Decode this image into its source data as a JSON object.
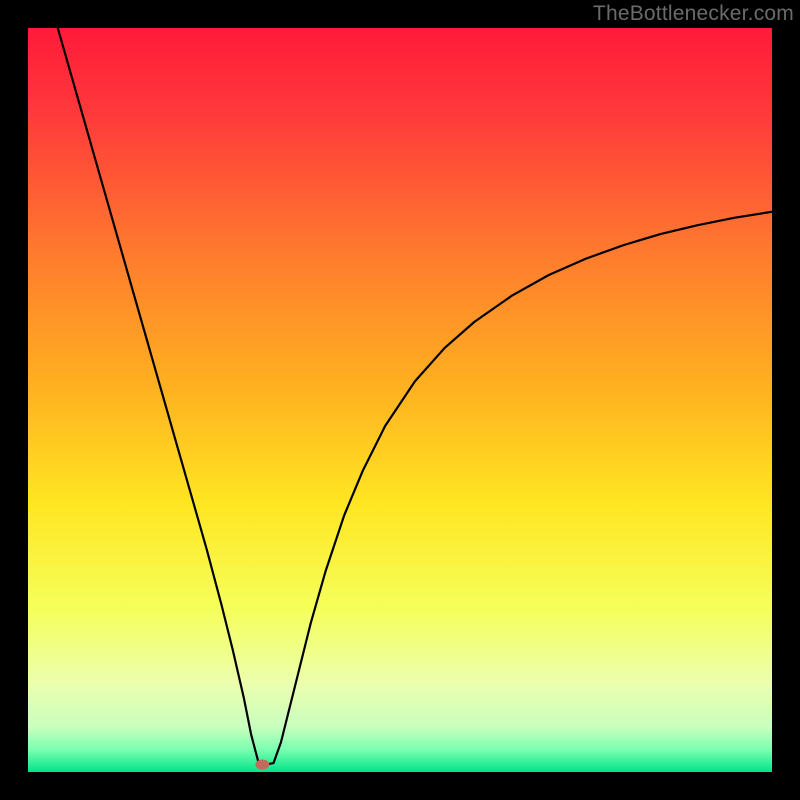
{
  "watermark": "TheBottlenecker.com",
  "chart_data": {
    "type": "line",
    "title": "",
    "xlabel": "",
    "ylabel": "",
    "xlim": [
      0,
      100
    ],
    "ylim": [
      0,
      100
    ],
    "grid": false,
    "background_gradient_stops": [
      {
        "pos": 0.0,
        "color": "#ff1a3a"
      },
      {
        "pos": 0.12,
        "color": "#ff3b3b"
      },
      {
        "pos": 0.3,
        "color": "#ff7a2e"
      },
      {
        "pos": 0.48,
        "color": "#ffb020"
      },
      {
        "pos": 0.64,
        "color": "#ffe622"
      },
      {
        "pos": 0.78,
        "color": "#f5ff5a"
      },
      {
        "pos": 0.88,
        "color": "#ecffad"
      },
      {
        "pos": 0.94,
        "color": "#c8ffbf"
      },
      {
        "pos": 0.97,
        "color": "#7affb0"
      },
      {
        "pos": 1.0,
        "color": "#00e48a"
      }
    ],
    "marker": {
      "x": 31.5,
      "y": 1.0,
      "color": "#c46a5c"
    },
    "series": [
      {
        "name": "bottleneck-curve",
        "color": "#000000",
        "x": [
          4.0,
          6.0,
          8.0,
          10.0,
          12.0,
          14.0,
          16.0,
          18.0,
          20.0,
          22.0,
          24.0,
          26.0,
          27.5,
          29.0,
          30.0,
          31.0,
          32.0,
          33.0,
          34.0,
          36.0,
          38.0,
          40.0,
          42.5,
          45.0,
          48.0,
          52.0,
          56.0,
          60.0,
          65.0,
          70.0,
          75.0,
          80.0,
          85.0,
          90.0,
          95.0,
          100.0
        ],
        "y": [
          100.0,
          93.0,
          86.0,
          79.0,
          72.0,
          65.0,
          58.0,
          51.0,
          44.0,
          37.0,
          30.0,
          22.5,
          16.5,
          10.0,
          5.0,
          1.2,
          1.0,
          1.2,
          4.0,
          12.0,
          20.0,
          27.0,
          34.5,
          40.5,
          46.5,
          52.5,
          57.0,
          60.5,
          64.0,
          66.8,
          69.0,
          70.8,
          72.3,
          73.5,
          74.5,
          75.3
        ]
      }
    ]
  }
}
